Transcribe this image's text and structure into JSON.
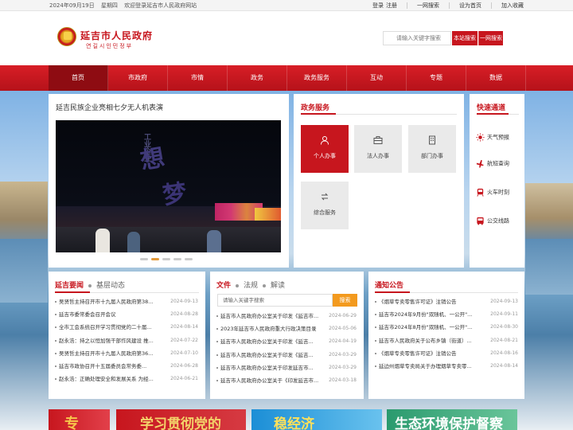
{
  "topbar": {
    "date": "2024年09月19日",
    "weekday": "星期四",
    "welcome": "欢迎登录延吉市人民政府网站",
    "login": "登录",
    "register": "注册",
    "one_search": "一网搜索",
    "set_home": "设为首页",
    "bookmark": "加入收藏"
  },
  "header": {
    "title": "延吉市人民政府",
    "subtitle": "연길시인민정부",
    "search_placeholder": "请输入关键字搜索",
    "btn_site": "本站搜索",
    "btn_web": "一网搜索"
  },
  "nav": [
    "首页",
    "市政府",
    "市情",
    "政务",
    "政务服务",
    "互动",
    "专题",
    "数据"
  ],
  "feature": {
    "headline": "延吉民族企业亮相七夕无人机表演",
    "drone_text_1": "想",
    "drone_text_2": "梦",
    "drone_text_3": "工业企业"
  },
  "services": {
    "title": "政务服务",
    "tiles": [
      "个人办事",
      "法人办事",
      "部门办事",
      "综合服务"
    ]
  },
  "fast": {
    "title": "快速通道",
    "items": [
      "天气预报",
      "航班查询",
      "火车时刻",
      "公交线路"
    ]
  },
  "news": {
    "tab_active": "延吉要闻",
    "tab_other": "基层动态",
    "items": [
      {
        "title": "吴贤哲主持召开市十九届人民政府第38...",
        "date": "2024-09-13"
      },
      {
        "title": "延吉市委常委会召开会议",
        "date": "2024-08-28"
      },
      {
        "title": "全市工会系统召开学习贯彻党的二十届...",
        "date": "2024-08-14"
      },
      {
        "title": "赵永浩：持之以恒加强干部作风建设 推...",
        "date": "2024-07-22"
      },
      {
        "title": "吴贤哲主持召开市十九届人民政府第36...",
        "date": "2024-07-10"
      },
      {
        "title": "延吉市政协召开十五届委员会常务委...",
        "date": "2024-06-28"
      },
      {
        "title": "赵永浩：正确处理安全和发展关系 为经...",
        "date": "2024-06-21"
      }
    ]
  },
  "docs": {
    "tab_active": "文件",
    "tab_2": "法规",
    "tab_3": "解读",
    "search_placeholder": "请输入关键字搜索",
    "search_btn": "搜索",
    "items": [
      {
        "title": "延吉市人民政府办公室关于印发《延吉市...",
        "date": "2024-06-29"
      },
      {
        "title": "2023年延吉市人民政府重大行政决策目录",
        "date": "2024-05-06"
      },
      {
        "title": "延吉市人民政府办公室关于印发《延吉...",
        "date": "2024-04-19"
      },
      {
        "title": "延吉市人民政府办公室关于印发《延吉...",
        "date": "2024-03-29"
      },
      {
        "title": "延吉市人民政府办公室关于印发延吉市...",
        "date": "2024-03-29"
      },
      {
        "title": "延吉市人民政府办公室关于《印发延吉市...",
        "date": "2024-03-18"
      }
    ]
  },
  "notice": {
    "title": "通知公告",
    "items": [
      {
        "title": "《烟草专卖零售许可证》注销公告",
        "date": "2024-09-13"
      },
      {
        "title": "延吉市2024年9月份\"双随机、一公开\"...",
        "date": "2024-09-11"
      },
      {
        "title": "延吉市2024年8月份\"双随机、一公开\"...",
        "date": "2024-08-30"
      },
      {
        "title": "延吉市人民政府关于公布乡镇（街道）...",
        "date": "2024-08-21"
      },
      {
        "title": "《烟草专卖零售许可证》注销公告",
        "date": "2024-08-16"
      },
      {
        "title": "延边州烟草专卖局关于办理烟草专卖零...",
        "date": "2024-08-14"
      }
    ]
  },
  "banners": [
    "专",
    "学习贯彻党的",
    "稳经济",
    "生态环境保护督察"
  ],
  "colors": {
    "brand_red": "#c7161e",
    "nav_active": "#8e0c12",
    "search_orange": "#f39a1e"
  }
}
